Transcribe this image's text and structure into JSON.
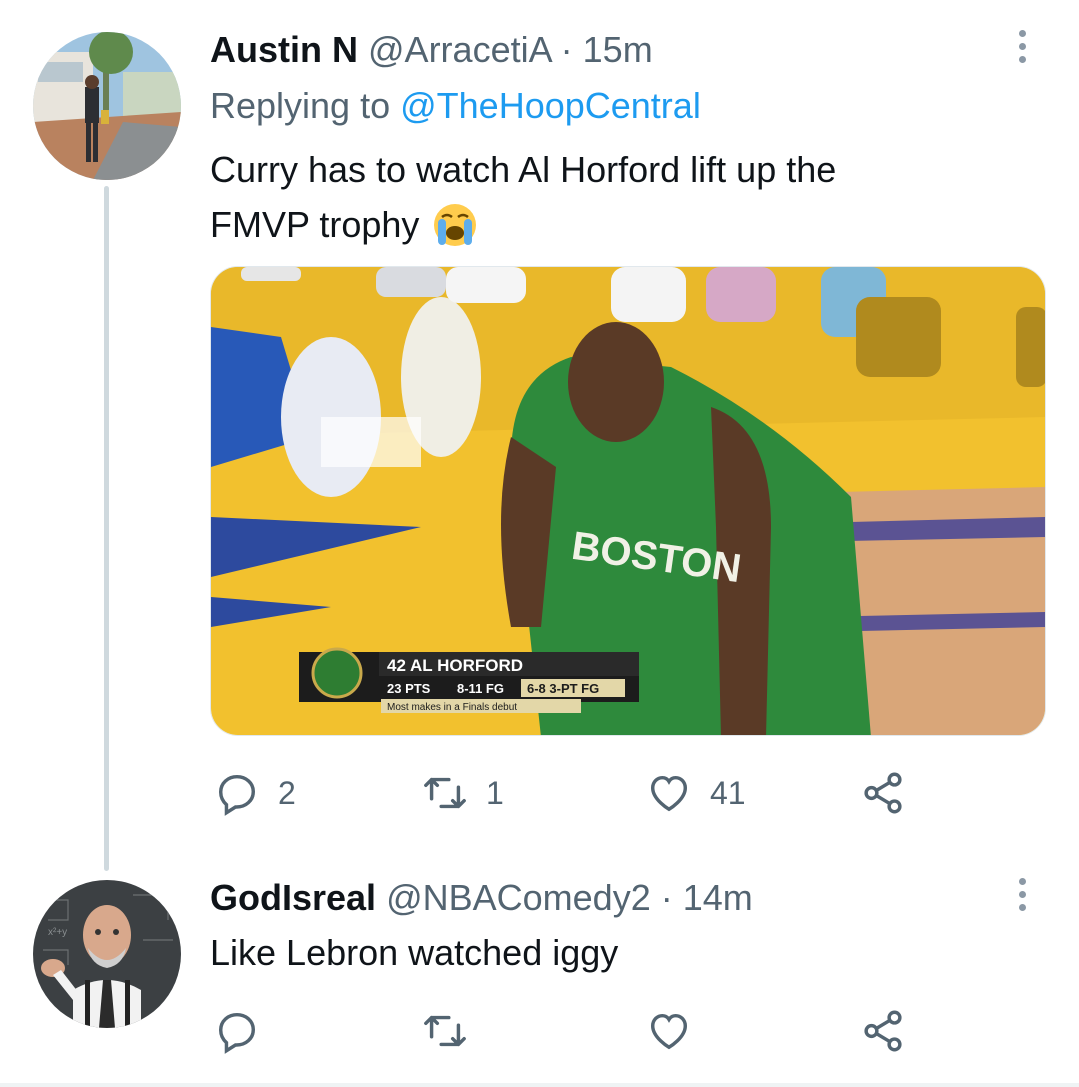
{
  "tweets": [
    {
      "name": "Austin N",
      "handle": "@ArracetiA",
      "separator": "·",
      "time": "15m",
      "replying_prefix": "Replying to",
      "replying_to": "@TheHoopCentral",
      "text_line1": "Curry has to watch Al Horford lift up the",
      "text_line2": "FMVP trophy",
      "emoji": "loudly-crying-face",
      "media": {
        "scorebug_title": "42 AL HORFORD",
        "stat1": "23 PTS",
        "stat2": "8-11 FG",
        "stat3": "6-8 3-PT FG",
        "note": "Most makes in a Finals debut",
        "jersey_text": "BOSTON"
      },
      "reply_count": "2",
      "retweet_count": "1",
      "like_count": "41"
    },
    {
      "name": "GodIsreal",
      "handle": "@NBAComedy2",
      "separator": "·",
      "time": "14m",
      "text_line1": "Like Lebron watched iggy"
    }
  ],
  "icons": [
    "more-icon",
    "reply-icon",
    "retweet-icon",
    "like-icon",
    "share-icon"
  ],
  "colors": {
    "link": "#1d9bf0",
    "secondary_text": "#536471",
    "thread_line": "#cfd9de",
    "court_yellow": "#f2c12e",
    "celtics_green": "#2e7d32"
  }
}
